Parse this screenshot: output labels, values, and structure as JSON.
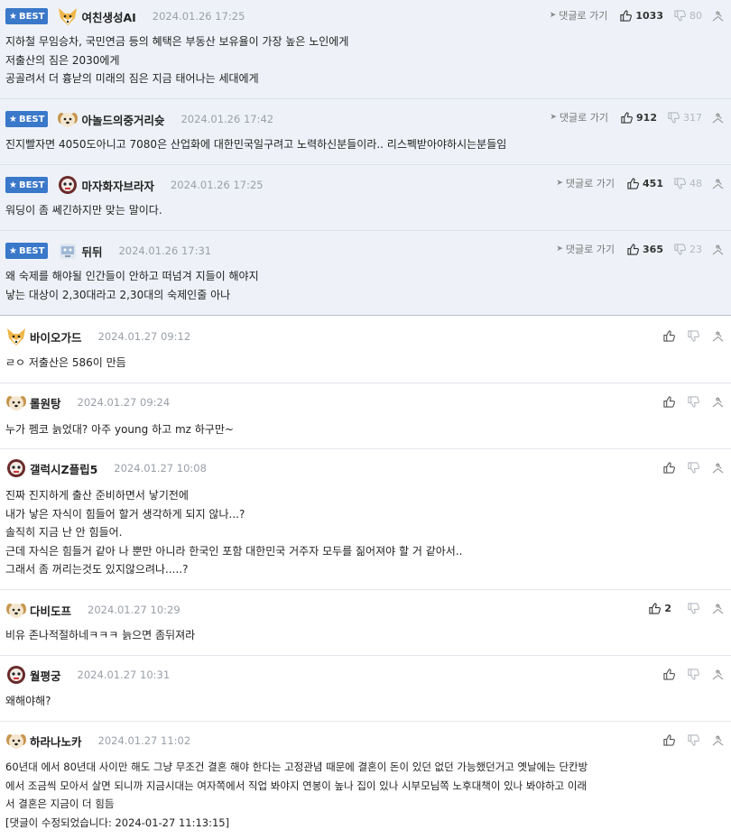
{
  "best_badge": "BEST",
  "reply_link": "댓글로 가기",
  "best_comments": [
    {
      "nick": "여친생성AI",
      "date": "2024.01.26 17:25",
      "likes": "1033",
      "dislikes": "80",
      "avatar": "fox-avatar-icon",
      "text": "지하철 무임승차, 국민연금 등의 혜택은 부동산 보유율이 가장 높은 노인에게\n저출산의 짐은 2030에게\n공골려서 더 흉낟의 미래의 짐은 지금 태어나는 세대에게"
    },
    {
      "nick": "아놀드의중거리슛",
      "date": "2024.01.26 17:42",
      "likes": "912",
      "dislikes": "317",
      "avatar": "dog-avatar-icon",
      "text": "진지빨자면 4050도아니고 7080은 산업화에 대한민국일구려고 노력하신분들이라.. 리스펙받아야하시는분들임"
    },
    {
      "nick": "마자화자브라자",
      "date": "2024.01.26 17:25",
      "likes": "451",
      "dislikes": "48",
      "avatar": "skull-avatar-icon",
      "text": "워딩이 좀 쎄긴하지만 맞는 말이다."
    },
    {
      "nick": "뒤뒤",
      "date": "2024.01.26 17:31",
      "likes": "365",
      "dislikes": "23",
      "avatar": "robot-avatar-icon",
      "text": "왜 숙제를 해야될 인간들이 안하고 떠넘겨 지들이 해야지\n낳는 대상이 2,30대라고 2,30대의 숙제인줄 아나"
    }
  ],
  "comments": [
    {
      "nick": "바이오가드",
      "date": "2024.01.27 09:12",
      "likes": "",
      "avatar": "fox-avatar-icon",
      "text": "ㄹㅇ 저출산은 586이 만듬"
    },
    {
      "nick": "롤원탕",
      "date": "2024.01.27 09:24",
      "likes": "",
      "avatar": "dog-avatar-icon",
      "text": "누가 펨코 늙었대? 아주 young 하고 mz 하구만~"
    },
    {
      "nick": "갤럭시Z플립5",
      "date": "2024.01.27 10:08",
      "likes": "",
      "avatar": "skull-avatar-icon",
      "text": "진짜 진지하게 출산 준비하면서 낳기전에\n내가 낳은 자식이 힘들어 할거 생각하게 되지 않나...?\n솔직히 지금 난 안 힘들어.\n근데 자식은 힘들거 같아 나 뿐만 아니라 한국인 포함 대한민국 거주자 모두를 짊어져야 할 거 같아서..\n그래서 좀 꺼리는것도 있지않으려나.....?"
    },
    {
      "nick": "다비도프",
      "date": "2024.01.27 10:29",
      "likes": "2",
      "avatar": "dog-avatar-icon",
      "text": "비유 존나적절하네ㅋㅋㅋ 늙으면 좀뒤져라"
    },
    {
      "nick": "월평궁",
      "date": "2024.01.27 10:31",
      "likes": "",
      "avatar": "skull-avatar-icon",
      "text": "왜해야해?"
    },
    {
      "nick": "하라나노카",
      "date": "2024.01.27 11:02",
      "likes": "",
      "avatar": "dog-avatar-icon",
      "text": "60년대 에서 80년대 사이만 해도 그냥 무조건 결혼 해야 한다는 고정관념 때문에 결혼이 돈이 있던 없던 가능했던거고 옛날에는 단칸방\n에서 조금씩 모아서 살면 되니까 지금시대는 여자쪽에서 직업 봐야지 연봉이 높나 집이 있나 시부모님쪽 노후대책이 있나 봐야하고 이래\n서 결혼은 지금이 더 힘듬\n[댓글이 수정되었습니다: 2024-01-27 11:13:15]"
    }
  ],
  "colors": {
    "best_bg": "#eef2f8",
    "badge": "#3a78c9",
    "date": "#9aa0a8",
    "divider": "#e3e6eb"
  }
}
